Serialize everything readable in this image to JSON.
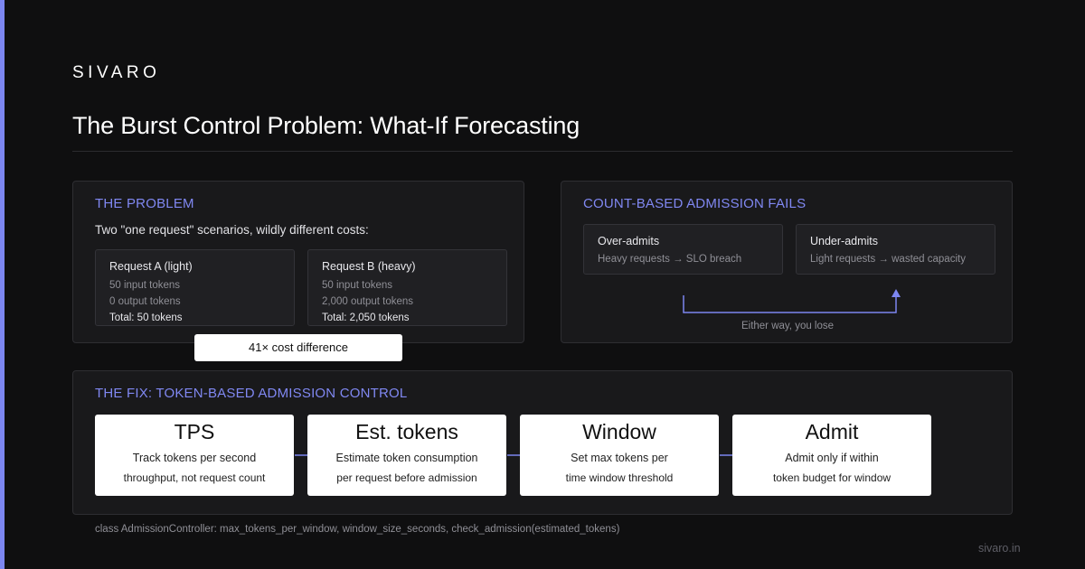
{
  "brand": "SIVARO",
  "title": "The Burst Control Problem: What-If Forecasting",
  "problem": {
    "heading": "THE PROBLEM",
    "subtitle": "Two \"one request\" scenarios, wildly different costs:",
    "request_a": {
      "title": "Request A (light)",
      "input": "50 input tokens",
      "output": "0 output tokens",
      "total": "Total: 50 tokens"
    },
    "request_b": {
      "title": "Request B (heavy)",
      "input": "50 input tokens",
      "output": "2,000 output tokens",
      "total": "Total: 2,050 tokens"
    },
    "cost_difference": "41× cost difference"
  },
  "count_based": {
    "heading": "COUNT-BASED ADMISSION FAILS",
    "over": {
      "title": "Over-admits",
      "desc": "Heavy requests → SLO breach"
    },
    "under": {
      "title": "Under-admits",
      "desc": "Light requests → wasted capacity"
    },
    "caption": "Either way, you lose"
  },
  "fix": {
    "heading": "THE FIX: TOKEN-BASED ADMISSION CONTROL",
    "steps": [
      {
        "title": "TPS",
        "line1": "Track tokens per second",
        "line2": "throughput, not request count"
      },
      {
        "title": "Est. tokens",
        "line1": "Estimate token consumption",
        "line2": "per request before admission"
      },
      {
        "title": "Window",
        "line1": "Set max tokens per",
        "line2": "time window threshold"
      },
      {
        "title": "Admit",
        "line1": "Admit only if within",
        "line2": "token budget for window"
      }
    ]
  },
  "code_line": "class AdmissionController: max_tokens_per_window, window_size_seconds, check_admission(estimated_tokens)",
  "domain": "sivaro.in",
  "colors": {
    "accent": "#7c86f0",
    "heading": "#8088f2",
    "background": "#0f0f10",
    "panel": "#19191b"
  }
}
